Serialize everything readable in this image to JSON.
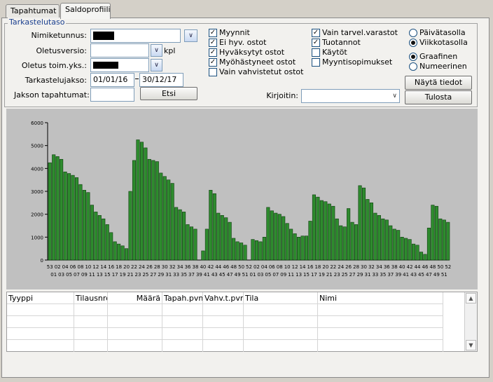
{
  "tabs": [
    "Tapahtumat",
    "Saldoprofiili"
  ],
  "filters": {
    "group_title": "Tarkastelutaso",
    "nimiketunnus_label": "Nimiketunnus:",
    "oletusversio_label": "Oletusversio:",
    "kpl_unit": "kpl",
    "oletus_toim_label": "Oletus toim.yks.:",
    "tarkastelujakso_label": "Tarkastelujakso:",
    "start_date": "01/01/16",
    "end_date": "30/12/17",
    "jakson_label": "Jakson tapahtumat:",
    "search_button": "Etsi"
  },
  "checkboxes_col1": [
    {
      "label": "Myynnit",
      "checked": true
    },
    {
      "label": "Ei hyv. ostot",
      "checked": true
    },
    {
      "label": "Hyväksytyt ostot",
      "checked": true
    },
    {
      "label": "Myöhästyneet ostot",
      "checked": true
    },
    {
      "label": "Vain vahvistetut ostot",
      "checked": false
    }
  ],
  "checkboxes_col2": [
    {
      "label": "Vain tarvel.varastot",
      "checked": true
    },
    {
      "label": "Tuotannot",
      "checked": true
    },
    {
      "label": "Käytöt",
      "checked": false
    },
    {
      "label": "Myyntisopimukset",
      "checked": false
    }
  ],
  "radio_level": [
    {
      "label": "Päivätasolla",
      "selected": false
    },
    {
      "label": "Viikkotasolla",
      "selected": true
    }
  ],
  "radio_view": [
    {
      "label": "Graafinen",
      "selected": true
    },
    {
      "label": "Numeerinen",
      "selected": false
    }
  ],
  "printer_label": "Kirjoitin:",
  "show_button": "Näytä tiedot",
  "print_button": "Tulosta",
  "table": {
    "columns": [
      "Tyyppi",
      "Tilausnro",
      "Määrä",
      "Tapah.pvm",
      "Vahv.t.pvm",
      "Tila",
      "Nimi"
    ]
  },
  "chart_data": {
    "type": "bar",
    "ylim": [
      0,
      6000
    ],
    "yticks": [
      "0",
      "1000",
      "2000",
      "3000",
      "4000",
      "5000",
      "6000"
    ],
    "bar_color": "#2e8b2e",
    "values": [
      4250,
      4600,
      4520,
      4400,
      3850,
      3780,
      3700,
      3600,
      3300,
      3050,
      2950,
      2400,
      2100,
      1950,
      1800,
      1550,
      1200,
      800,
      700,
      620,
      500,
      3000,
      4350,
      5250,
      5150,
      4900,
      4400,
      4350,
      4300,
      3800,
      3650,
      3500,
      3350,
      2300,
      2200,
      2100,
      1550,
      1450,
      1350,
      0,
      400,
      1350,
      3050,
      2900,
      2050,
      1950,
      1850,
      1650,
      950,
      800,
      750,
      650,
      0,
      900,
      850,
      800,
      1000,
      2300,
      2150,
      2050,
      2000,
      1900,
      1600,
      1350,
      1150,
      1000,
      1050,
      1050,
      1700,
      2850,
      2750,
      2600,
      2550,
      2450,
      2350,
      1800,
      1500,
      1450,
      2250,
      1650,
      1550,
      3250,
      3150,
      2650,
      2500,
      2050,
      1950,
      1800,
      1750,
      1500,
      1350,
      1300,
      1000,
      950,
      900,
      700,
      650,
      350,
      250,
      1400,
      2400,
      2350,
      1800,
      1750,
      1650
    ],
    "xlabels_top": [
      "53",
      "02",
      "04",
      "06",
      "08",
      "10",
      "12",
      "14",
      "16",
      "18",
      "20",
      "22",
      "24",
      "26",
      "28",
      "30",
      "32",
      "34",
      "36",
      "38",
      "40",
      "42",
      "44",
      "46",
      "48",
      "50",
      "52",
      "02",
      "04",
      "06",
      "08",
      "10",
      "12",
      "14",
      "16",
      "18",
      "20",
      "22",
      "24",
      "26",
      "28",
      "30",
      "32",
      "34",
      "36",
      "38",
      "40",
      "42",
      "44",
      "46",
      "48",
      "50",
      "52"
    ],
    "xlabels_bottom": [
      "01",
      "03",
      "05",
      "07",
      "09",
      "11",
      "13",
      "15",
      "17",
      "19",
      "21",
      "23",
      "25",
      "27",
      "29",
      "31",
      "33",
      "35",
      "37",
      "39",
      "41",
      "43",
      "45",
      "47",
      "49",
      "51",
      "01",
      "03",
      "05",
      "07",
      "09",
      "11",
      "13",
      "15",
      "17",
      "19",
      "21",
      "23",
      "25",
      "27",
      "29",
      "31",
      "33",
      "35",
      "37",
      "39",
      "41",
      "43",
      "45",
      "47",
      "49",
      "51"
    ]
  }
}
